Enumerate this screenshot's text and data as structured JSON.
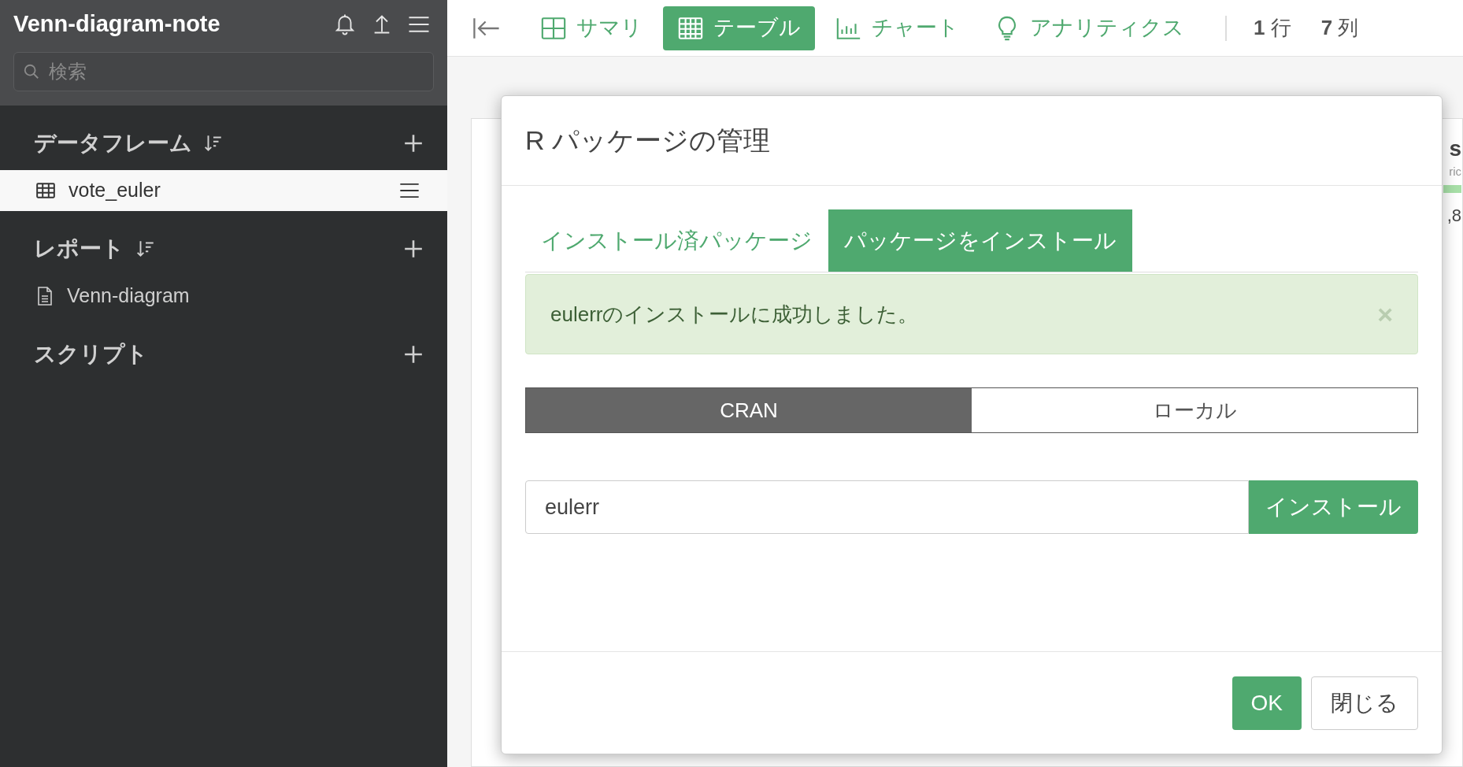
{
  "sidebar": {
    "title": "Venn-diagram-note",
    "search": {
      "placeholder": "検索"
    },
    "sections": [
      {
        "title": "データフレーム",
        "sortable": true,
        "items": [
          {
            "label": "vote_euler",
            "kind": "table",
            "selected": true
          }
        ]
      },
      {
        "title": "レポート",
        "sortable": true,
        "items": [
          {
            "label": "Venn-diagram",
            "kind": "report",
            "selected": false
          }
        ]
      },
      {
        "title": "スクリプト",
        "sortable": false
      }
    ]
  },
  "toolbar": {
    "views": [
      {
        "label": "サマリ",
        "kind": "summary",
        "selected": false
      },
      {
        "label": "テーブル",
        "kind": "table",
        "selected": true
      },
      {
        "label": "チャート",
        "kind": "chart",
        "selected": false
      },
      {
        "label": "アナリティクス",
        "kind": "analytics",
        "selected": false
      }
    ],
    "counts": [
      "**1** 行",
      "**7** 列"
    ]
  },
  "background_table": {
    "header": "s",
    "type": "ric",
    "value": ",8"
  },
  "modal": {
    "title": "R パッケージの管理",
    "tabs": [
      {
        "label": "インストール済パッケージ",
        "selected": false
      },
      {
        "label": "パッケージをインストール",
        "selected": true
      }
    ],
    "alert": {
      "message": "eulerrのインストールに成功しました。",
      "close": "×"
    },
    "sources": [
      {
        "label": "CRAN",
        "selected": true
      },
      {
        "label": "ローカル",
        "selected": false
      }
    ],
    "package_input": {
      "value": "eulerr"
    },
    "install_button": "インストール",
    "buttons": [
      {
        "label": "OK",
        "kind": "primary"
      },
      {
        "label": "閉じる",
        "kind": "default"
      }
    ]
  }
}
